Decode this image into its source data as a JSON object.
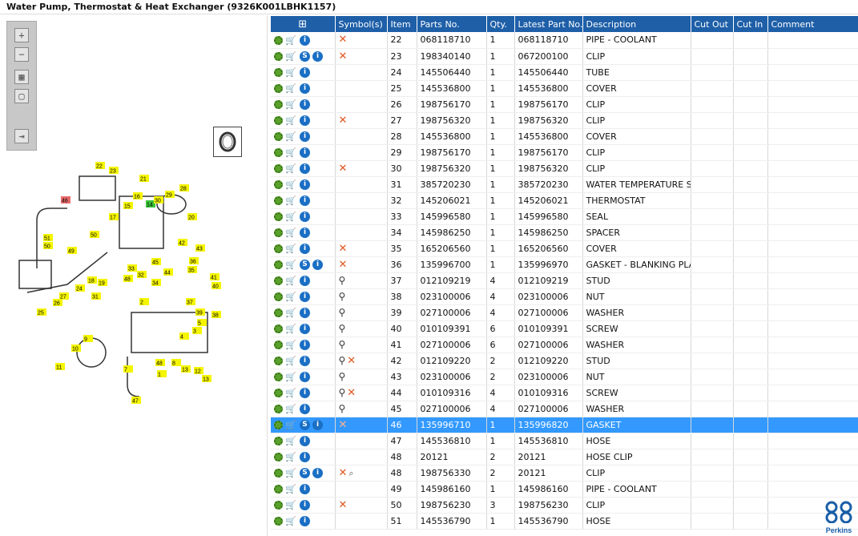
{
  "window_title": "Water Pump, Thermostat & Heat Exchanger (9326K001LBHK1157)",
  "toolbar": {
    "zoom_in": "+",
    "zoom_out": "−",
    "fit": "▦",
    "reset": "▢",
    "export": "⇥"
  },
  "diagram_labels": [
    "22",
    "23",
    "21",
    "46",
    "16",
    "15",
    "14",
    "30",
    "29",
    "28",
    "17",
    "20",
    "51",
    "50",
    "49",
    "50",
    "42",
    "43",
    "18",
    "19",
    "24",
    "25",
    "26",
    "27",
    "45",
    "48",
    "32",
    "33",
    "34",
    "44",
    "36",
    "35",
    "41",
    "40",
    "37",
    "39",
    "38",
    "31",
    "2",
    "5",
    "3",
    "4",
    "9",
    "10",
    "11",
    "1",
    "7",
    "48",
    "8",
    "13",
    "12",
    "13",
    "47"
  ],
  "grid": {
    "columns": [
      "",
      "Symbol(s)",
      "Item",
      "Parts No.",
      "Qty.",
      "Latest Part No.",
      "Description",
      "Cut Out",
      "Cut In",
      "Comment"
    ],
    "rows": [
      {
        "s": false,
        "x": true,
        "pin": false,
        "mag": false,
        "item": "22",
        "part": "068118710",
        "qty": "1",
        "latest": "068118710",
        "desc": "PIPE - COOLANT"
      },
      {
        "s": true,
        "x": true,
        "pin": false,
        "mag": false,
        "item": "23",
        "part": "198340140",
        "qty": "1",
        "latest": "067200100",
        "desc": "CLIP"
      },
      {
        "s": false,
        "x": false,
        "pin": false,
        "mag": false,
        "item": "24",
        "part": "145506440",
        "qty": "1",
        "latest": "145506440",
        "desc": "TUBE"
      },
      {
        "s": false,
        "x": false,
        "pin": false,
        "mag": false,
        "item": "25",
        "part": "145536800",
        "qty": "1",
        "latest": "145536800",
        "desc": "COVER"
      },
      {
        "s": false,
        "x": false,
        "pin": false,
        "mag": false,
        "item": "26",
        "part": "198756170",
        "qty": "1",
        "latest": "198756170",
        "desc": "CLIP"
      },
      {
        "s": false,
        "x": true,
        "pin": false,
        "mag": false,
        "item": "27",
        "part": "198756320",
        "qty": "1",
        "latest": "198756320",
        "desc": "CLIP"
      },
      {
        "s": false,
        "x": false,
        "pin": false,
        "mag": false,
        "item": "28",
        "part": "145536800",
        "qty": "1",
        "latest": "145536800",
        "desc": "COVER"
      },
      {
        "s": false,
        "x": false,
        "pin": false,
        "mag": false,
        "item": "29",
        "part": "198756170",
        "qty": "1",
        "latest": "198756170",
        "desc": "CLIP"
      },
      {
        "s": false,
        "x": true,
        "pin": false,
        "mag": false,
        "item": "30",
        "part": "198756320",
        "qty": "1",
        "latest": "198756320",
        "desc": "CLIP"
      },
      {
        "s": false,
        "x": false,
        "pin": false,
        "mag": false,
        "item": "31",
        "part": "385720230",
        "qty": "1",
        "latest": "385720230",
        "desc": "WATER TEMPERATURE SEN"
      },
      {
        "s": false,
        "x": false,
        "pin": false,
        "mag": false,
        "item": "32",
        "part": "145206021",
        "qty": "1",
        "latest": "145206021",
        "desc": "THERMOSTAT"
      },
      {
        "s": false,
        "x": false,
        "pin": false,
        "mag": false,
        "item": "33",
        "part": "145996580",
        "qty": "1",
        "latest": "145996580",
        "desc": "SEAL"
      },
      {
        "s": false,
        "x": false,
        "pin": false,
        "mag": false,
        "item": "34",
        "part": "145986250",
        "qty": "1",
        "latest": "145986250",
        "desc": "SPACER"
      },
      {
        "s": false,
        "x": true,
        "pin": false,
        "mag": false,
        "item": "35",
        "part": "165206560",
        "qty": "1",
        "latest": "165206560",
        "desc": "COVER"
      },
      {
        "s": true,
        "x": true,
        "pin": false,
        "mag": false,
        "item": "36",
        "part": "135996700",
        "qty": "1",
        "latest": "135996970",
        "desc": "GASKET - BLANKING PLATE"
      },
      {
        "s": false,
        "x": false,
        "pin": true,
        "mag": false,
        "item": "37",
        "part": "012109219",
        "qty": "4",
        "latest": "012109219",
        "desc": "STUD"
      },
      {
        "s": false,
        "x": false,
        "pin": true,
        "mag": false,
        "item": "38",
        "part": "023100006",
        "qty": "4",
        "latest": "023100006",
        "desc": "NUT"
      },
      {
        "s": false,
        "x": false,
        "pin": true,
        "mag": false,
        "item": "39",
        "part": "027100006",
        "qty": "4",
        "latest": "027100006",
        "desc": "WASHER"
      },
      {
        "s": false,
        "x": false,
        "pin": true,
        "mag": false,
        "item": "40",
        "part": "010109391",
        "qty": "6",
        "latest": "010109391",
        "desc": "SCREW"
      },
      {
        "s": false,
        "x": false,
        "pin": true,
        "mag": false,
        "item": "41",
        "part": "027100006",
        "qty": "6",
        "latest": "027100006",
        "desc": "WASHER"
      },
      {
        "s": false,
        "x": true,
        "pin": true,
        "mag": false,
        "item": "42",
        "part": "012109220",
        "qty": "2",
        "latest": "012109220",
        "desc": "STUD"
      },
      {
        "s": false,
        "x": false,
        "pin": true,
        "mag": false,
        "item": "43",
        "part": "023100006",
        "qty": "2",
        "latest": "023100006",
        "desc": "NUT"
      },
      {
        "s": false,
        "x": true,
        "pin": true,
        "mag": false,
        "item": "44",
        "part": "010109316",
        "qty": "4",
        "latest": "010109316",
        "desc": "SCREW"
      },
      {
        "s": false,
        "x": false,
        "pin": true,
        "mag": false,
        "item": "45",
        "part": "027100006",
        "qty": "4",
        "latest": "027100006",
        "desc": "WASHER"
      },
      {
        "s": true,
        "x": true,
        "pin": false,
        "mag": false,
        "item": "46",
        "part": "135996710",
        "qty": "1",
        "latest": "135996820",
        "desc": "GASKET",
        "selected": true
      },
      {
        "s": false,
        "x": false,
        "pin": false,
        "mag": false,
        "item": "47",
        "part": "145536810",
        "qty": "1",
        "latest": "145536810",
        "desc": "HOSE"
      },
      {
        "s": false,
        "x": false,
        "pin": false,
        "mag": false,
        "item": "48",
        "part": "20121",
        "qty": "2",
        "latest": "20121",
        "desc": "HOSE CLIP"
      },
      {
        "s": true,
        "x": true,
        "pin": false,
        "mag": true,
        "item": "48",
        "part": "198756330",
        "qty": "2",
        "latest": "20121",
        "desc": "CLIP"
      },
      {
        "s": false,
        "x": false,
        "pin": false,
        "mag": false,
        "item": "49",
        "part": "145986160",
        "qty": "1",
        "latest": "145986160",
        "desc": "PIPE - COOLANT"
      },
      {
        "s": false,
        "x": true,
        "pin": false,
        "mag": false,
        "item": "50",
        "part": "198756230",
        "qty": "3",
        "latest": "198756230",
        "desc": "CLIP"
      },
      {
        "s": false,
        "x": false,
        "pin": false,
        "mag": false,
        "item": "51",
        "part": "145536790",
        "qty": "1",
        "latest": "145536790",
        "desc": "HOSE"
      }
    ]
  },
  "icons": {
    "row_tools": [
      "gear-icon",
      "cart-icon",
      "info-icon"
    ],
    "s_badge": "S",
    "info_glyph": "i",
    "x_glyph": "✕",
    "pin_glyph": "⚲",
    "mag_glyph": "⌕",
    "cart_glyph": "🛒",
    "header_icon": "⊞"
  },
  "brand": {
    "name": "Perkins",
    "accent": "#1e5fa8",
    "select": "#3399ff",
    "x_color": "#e0561e"
  }
}
